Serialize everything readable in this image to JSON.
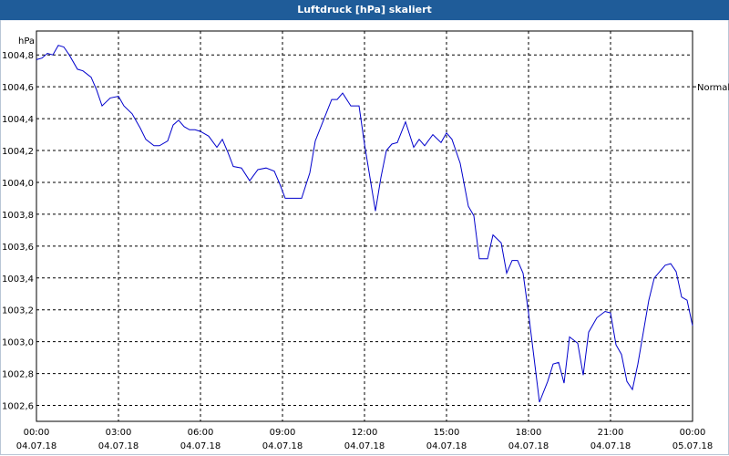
{
  "window": {
    "title": "Luftdruck [hPa] skaliert"
  },
  "chart_data": {
    "type": "line",
    "title": "Luftdruck [hPa] skaliert",
    "ylabel": "hPa",
    "xlabel": "",
    "ylim": [
      1002.5,
      1004.95
    ],
    "y_ticks": [
      "1002,6",
      "1002,8",
      "1003,0",
      "1003,2",
      "1003,4",
      "1003,6",
      "1003,8",
      "1004,0",
      "1004,2",
      "1004,4",
      "1004,6",
      "1004,8"
    ],
    "y_tick_values": [
      1002.6,
      1002.8,
      1003.0,
      1003.2,
      1003.4,
      1003.6,
      1003.8,
      1004.0,
      1004.2,
      1004.4,
      1004.6,
      1004.8
    ],
    "x_range_hours": [
      0,
      24
    ],
    "x_ticks": [
      {
        "time": "00:00",
        "date": "04.07.18",
        "hour": 0
      },
      {
        "time": "03:00",
        "date": "04.07.18",
        "hour": 3
      },
      {
        "time": "06:00",
        "date": "04.07.18",
        "hour": 6
      },
      {
        "time": "09:00",
        "date": "04.07.18",
        "hour": 9
      },
      {
        "time": "12:00",
        "date": "04.07.18",
        "hour": 12
      },
      {
        "time": "15:00",
        "date": "04.07.18",
        "hour": 15
      },
      {
        "time": "18:00",
        "date": "04.07.18",
        "hour": 18
      },
      {
        "time": "21:00",
        "date": "04.07.18",
        "hour": 21
      },
      {
        "time": "00:00",
        "date": "05.07.18",
        "hour": 24
      }
    ],
    "grid": true,
    "reference_line": {
      "label": "Normal",
      "value": 1004.6
    },
    "series": [
      {
        "color": "#0000cc",
        "x_hours": [
          0,
          0.2,
          0.4,
          0.6,
          0.8,
          1.0,
          1.2,
          1.5,
          1.7,
          2.0,
          2.2,
          2.4,
          2.7,
          3.0,
          3.2,
          3.5,
          3.8,
          4.0,
          4.3,
          4.5,
          4.8,
          5.0,
          5.2,
          5.4,
          5.6,
          5.8,
          6.0,
          6.3,
          6.6,
          6.8,
          7.0,
          7.2,
          7.5,
          7.8,
          8.1,
          8.4,
          8.7,
          8.9,
          9.1,
          9.4,
          9.7,
          10.0,
          10.2,
          10.5,
          10.8,
          11.0,
          11.2,
          11.5,
          11.8,
          12.0,
          12.2,
          12.4,
          12.6,
          12.8,
          13.0,
          13.2,
          13.5,
          13.8,
          14.0,
          14.2,
          14.5,
          14.8,
          15.0,
          15.2,
          15.5,
          15.8,
          16.0,
          16.2,
          16.5,
          16.7,
          17.0,
          17.2,
          17.4,
          17.6,
          17.8,
          18.0,
          18.2,
          18.4,
          18.7,
          18.9,
          19.1,
          19.3,
          19.5,
          19.8,
          20.0,
          20.2,
          20.5,
          20.8,
          21.0,
          21.2,
          21.4,
          21.6,
          21.8,
          22.0,
          22.2,
          22.4,
          22.6,
          22.8,
          23.0,
          23.2,
          23.4,
          23.6,
          23.8,
          24.0
        ],
        "values": [
          1004.77,
          1004.78,
          1004.81,
          1004.8,
          1004.86,
          1004.85,
          1004.8,
          1004.71,
          1004.7,
          1004.66,
          1004.58,
          1004.48,
          1004.53,
          1004.54,
          1004.48,
          1004.43,
          1004.34,
          1004.27,
          1004.23,
          1004.23,
          1004.26,
          1004.36,
          1004.39,
          1004.35,
          1004.33,
          1004.33,
          1004.32,
          1004.29,
          1004.22,
          1004.27,
          1004.19,
          1004.1,
          1004.09,
          1004.01,
          1004.08,
          1004.09,
          1004.07,
          1003.99,
          1003.9,
          1003.9,
          1003.9,
          1004.06,
          1004.26,
          1004.39,
          1004.52,
          1004.52,
          1004.56,
          1004.48,
          1004.48,
          1004.24,
          1004.03,
          1003.82,
          1004.03,
          1004.2,
          1004.24,
          1004.25,
          1004.38,
          1004.22,
          1004.27,
          1004.23,
          1004.3,
          1004.25,
          1004.31,
          1004.27,
          1004.12,
          1003.85,
          1003.79,
          1003.52,
          1003.52,
          1003.67,
          1003.62,
          1003.43,
          1003.51,
          1003.51,
          1003.43,
          1003.18,
          1002.9,
          1002.62,
          1002.75,
          1002.86,
          1002.87,
          1002.74,
          1003.03,
          1002.99,
          1002.79,
          1003.06,
          1003.15,
          1003.19,
          1003.18,
          1002.98,
          1002.92,
          1002.75,
          1002.7,
          1002.86,
          1003.06,
          1003.26,
          1003.4,
          1003.44,
          1003.48,
          1003.49,
          1003.44,
          1003.28,
          1003.26,
          1003.1
        ]
      }
    ]
  }
}
